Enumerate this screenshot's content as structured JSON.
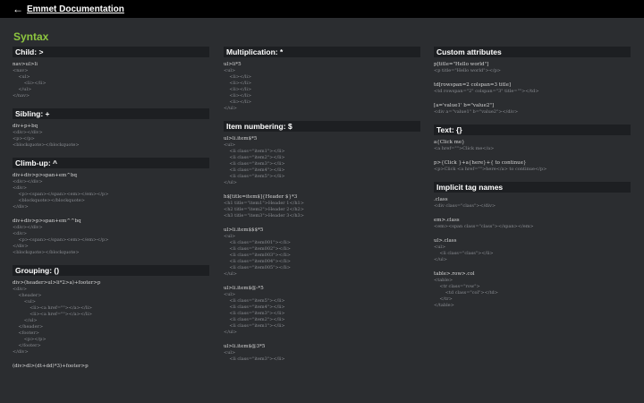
{
  "header": {
    "back_icon": "←",
    "title": "Emmet Documentation"
  },
  "page_title": "Syntax",
  "columns": [
    {
      "sections": [
        {
          "heading": "Child: >",
          "examples": [
            {
              "abbr": "nav>ul>li",
              "expansion": "<nav>\n    <ul>\n        <li></li>\n    </ul>\n</nav>"
            }
          ]
        },
        {
          "heading": "Sibling: +",
          "examples": [
            {
              "abbr": "div+p+bq",
              "expansion": "<div></div>\n<p></p>\n<blockquote></blockquote>"
            }
          ]
        },
        {
          "heading": "Climb-up: ^",
          "examples": [
            {
              "abbr": "div+div>p>span+em^bq",
              "expansion": "<div></div>\n<div>\n    <p><span></span><em></em></p>\n    <blockquote></blockquote>\n</div>"
            },
            {
              "abbr": "div+div>p>span+em^^bq",
              "expansion": "<div></div>\n<div>\n    <p><span></span><em></em></p>\n</div>\n<blockquote></blockquote>"
            }
          ]
        },
        {
          "heading": "Grouping: ()",
          "examples": [
            {
              "abbr": "div>(header>ul>li*2>a)+footer>p",
              "expansion": "<div>\n    <header>\n        <ul>\n            <li><a href=\"\"></a></li>\n            <li><a href=\"\"></a></li>\n        </ul>\n    </header>\n    <footer>\n        <p></p>\n    </footer>\n</div>"
            },
            {
              "abbr": "(div>dl>(dt+dd)*3)+footer>p",
              "expansion": ""
            }
          ]
        }
      ]
    },
    {
      "sections": [
        {
          "heading": "Multiplication: *",
          "examples": [
            {
              "abbr": "ul>li*5",
              "expansion": "<ul>\n    <li></li>\n    <li></li>\n    <li></li>\n    <li></li>\n    <li></li>\n</ul>"
            }
          ]
        },
        {
          "heading": "Item numbering: $",
          "examples": [
            {
              "abbr": "ul>li.item$*5",
              "expansion": "<ul>\n    <li class=\"item1\"></li>\n    <li class=\"item2\"></li>\n    <li class=\"item3\"></li>\n    <li class=\"item4\"></li>\n    <li class=\"item5\"></li>\n</ul>"
            },
            {
              "abbr": "h$[title=item$]{Header $}*3",
              "expansion": "<h1 title=\"item1\">Header 1</h1>\n<h2 title=\"item2\">Header 2</h2>\n<h3 title=\"item3\">Header 3</h3>"
            },
            {
              "abbr": "ul>li.item$$$*5",
              "expansion": "<ul>\n    <li class=\"item001\"></li>\n    <li class=\"item002\"></li>\n    <li class=\"item003\"></li>\n    <li class=\"item004\"></li>\n    <li class=\"item005\"></li>\n</ul>"
            },
            {
              "abbr": "ul>li.item$@-*5",
              "expansion": "<ul>\n    <li class=\"item5\"></li>\n    <li class=\"item4\"></li>\n    <li class=\"item3\"></li>\n    <li class=\"item2\"></li>\n    <li class=\"item1\"></li>\n</ul>"
            },
            {
              "abbr": "ul>li.item$@3*5",
              "expansion": "<ul>\n    <li class=\"item3\"></li>"
            }
          ]
        }
      ]
    },
    {
      "sections": [
        {
          "heading": "Custom attributes",
          "examples": [
            {
              "abbr": "p[title=\"Hello world\"]",
              "expansion": "<p title=\"Hello world\"></p>"
            },
            {
              "abbr": "td[rowspan=2 colspan=3 title]",
              "expansion": "<td rowspan=\"2\" colspan=\"3\" title=\"\"></td>"
            },
            {
              "abbr": "[a='value1' b=\"value2\"]",
              "expansion": "<div a=\"value1\" b=\"value2\"></div>"
            }
          ]
        },
        {
          "heading": "Text: {}",
          "examples": [
            {
              "abbr": "a{Click me}",
              "expansion": "<a href=\"\">Click me</a>"
            },
            {
              "abbr": "p>{Click }+a{here}+{ to continue}",
              "expansion": "<p>Click <a href=\"\">here</a> to continue</p>"
            }
          ]
        },
        {
          "heading": "Implicit tag names",
          "examples": [
            {
              "abbr": ".class",
              "expansion": "<div class=\"class\"></div>"
            },
            {
              "abbr": "em>.class",
              "expansion": "<em><span class=\"class\"></span></em>"
            },
            {
              "abbr": "ul>.class",
              "expansion": "<ul>\n    <li class=\"class\"></li>\n</ul>"
            },
            {
              "abbr": "table>.row>.col",
              "expansion": "<table>\n    <tr class=\"row\">\n        <td class=\"col\"></td>\n    </tr>\n</table>"
            }
          ]
        }
      ]
    }
  ]
}
